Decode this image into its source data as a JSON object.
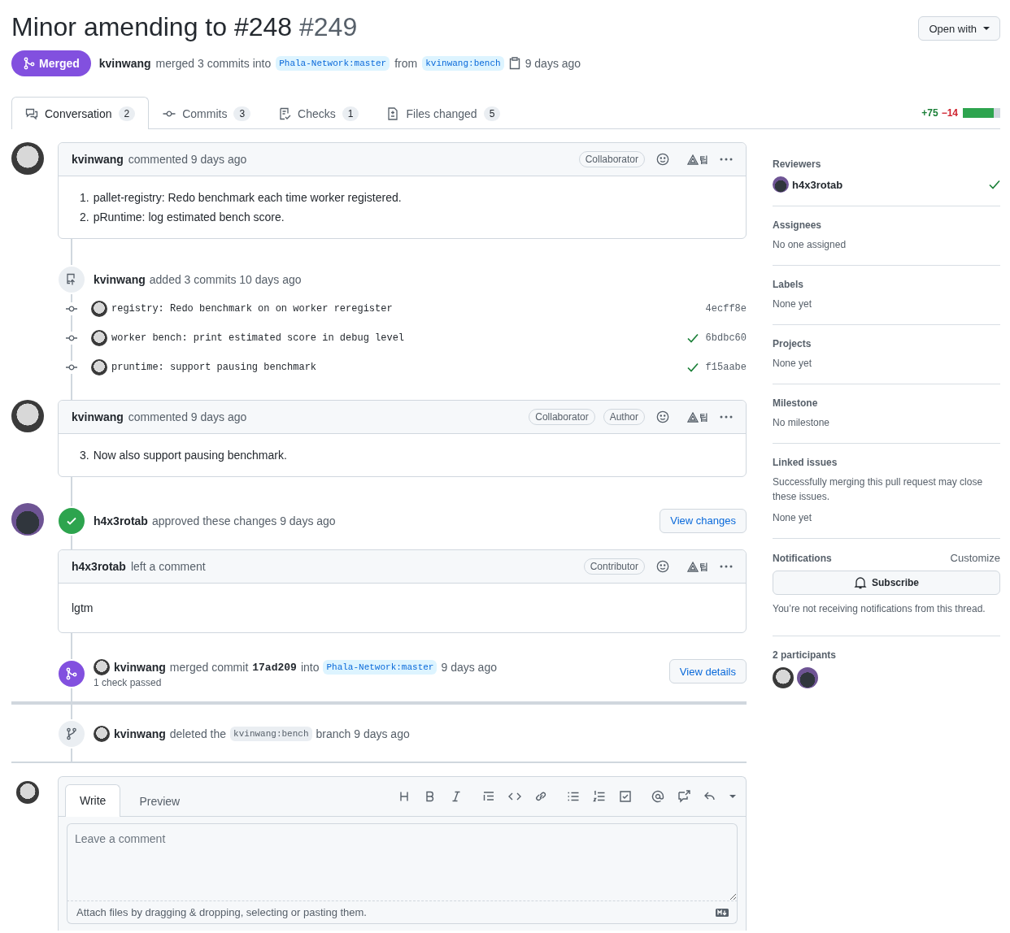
{
  "title": "Minor amending to #248",
  "number": "#249",
  "open_with": "Open with",
  "state": {
    "kind": "merged",
    "label": "Merged"
  },
  "summary": {
    "author": "kvinwang",
    "text": "merged 3 commits into",
    "base": "Phala-Network:master",
    "from": "from",
    "head": "kvinwang:bench",
    "time": "9 days ago"
  },
  "tabs": [
    {
      "kind": "conversation",
      "label": "Conversation",
      "count": "2",
      "selected": true
    },
    {
      "kind": "commits",
      "label": "Commits",
      "count": "3",
      "selected": false
    },
    {
      "kind": "checks",
      "label": "Checks",
      "count": "1",
      "selected": false
    },
    {
      "kind": "files",
      "label": "Files changed",
      "count": "5",
      "selected": false
    }
  ],
  "diffstat": {
    "added": "+75",
    "removed": "−14",
    "level": 0.82
  },
  "timeline": [
    {
      "kind": "comment",
      "avatar": {
        "kind": "person"
      },
      "author": "kvinwang",
      "action": "commented 9 days ago",
      "badges": [
        "Collaborator"
      ],
      "tip": "팁",
      "items": [
        {
          "number": "1.",
          "text": "pallet-registry: Redo benchmark each time worker registered."
        },
        {
          "number": "2.",
          "text": "pRuntime: log estimated bench score."
        }
      ]
    },
    {
      "kind": "commits",
      "author": "kvinwang",
      "text": "added 3 commits 10 days ago",
      "commits": [
        {
          "message": "registry: Redo benchmark on on worker reregister",
          "sha": "4ecff8e",
          "checked": false
        },
        {
          "message": "worker bench: print estimated score in debug level",
          "sha": "6bdbc60",
          "checked": true
        },
        {
          "message": "pruntime: support pausing benchmark",
          "sha": "f15aabe",
          "checked": true
        }
      ]
    },
    {
      "kind": "comment",
      "avatar": {
        "kind": "person"
      },
      "author": "kvinwang",
      "action": "commented 9 days ago",
      "badges": [
        "Collaborator",
        "Author"
      ],
      "tip": "팁",
      "items": [
        {
          "number": "3.",
          "text": "Now also support pausing benchmark."
        }
      ]
    },
    {
      "kind": "review",
      "avatar": {
        "kind": "cat"
      },
      "author": "h4x3rotab",
      "text": "approved these changes 9 days ago",
      "button": "View changes"
    },
    {
      "kind": "comment",
      "author": "h4x3rotab",
      "action": "left a comment",
      "badges": [
        "Contributor"
      ],
      "tip": "팁",
      "paragraphs": [
        "lgtm"
      ]
    },
    {
      "kind": "merged",
      "author": "kvinwang",
      "text": "merged commit",
      "sha": "17ad209",
      "into": "into",
      "branch": "Phala-Network:master",
      "time": "9 days ago",
      "note": "1 check passed",
      "button": "View details"
    },
    {
      "kind": "deleted",
      "author": "kvinwang",
      "text": "deleted the",
      "branch": "kvinwang:bench",
      "time": "branch 9 days ago"
    }
  ],
  "composer": {
    "tabs": [
      {
        "label": "Write",
        "selected": true
      },
      {
        "label": "Preview",
        "selected": false
      }
    ],
    "placeholder": "Leave a comment",
    "footer": "Attach files by dragging & dropping, selecting or pasting them."
  },
  "sidebar": [
    {
      "kind": "reviewers",
      "heading": "Reviewers",
      "reviewers": [
        {
          "name": "h4x3rotab",
          "approved": true
        }
      ]
    },
    {
      "kind": "text",
      "heading": "Assignees",
      "text": "No one assigned"
    },
    {
      "kind": "text",
      "heading": "Labels",
      "text": "None yet"
    },
    {
      "kind": "text",
      "heading": "Projects",
      "text": "None yet"
    },
    {
      "kind": "text",
      "heading": "Milestone",
      "text": "No milestone"
    },
    {
      "kind": "linked",
      "heading": "Linked issues",
      "description": "Successfully merging this pull request may close these issues.",
      "text": "None yet"
    },
    {
      "kind": "notifications",
      "heading": "Notifications",
      "link": "Customize",
      "button": "Subscribe",
      "note": "You’re not receiving notifications from this thread."
    },
    {
      "kind": "participants",
      "heading": "2 participants",
      "avatars": [
        {
          "kind": "person"
        },
        {
          "kind": "cat"
        }
      ]
    }
  ]
}
